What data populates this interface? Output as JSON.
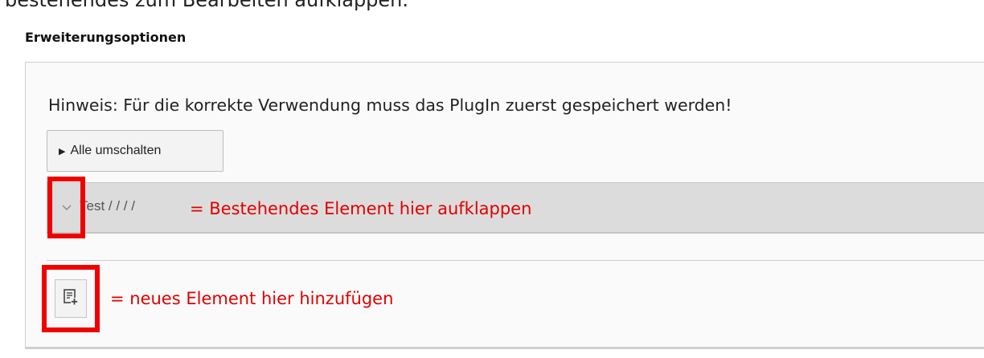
{
  "top_caption": "bestehendes zum Bearbeiten aufklappen.",
  "section_title": "Erweiterungsoptionen",
  "hint": "Hinweis: Für die korrekte Verwendung muss das PlugIn zuerst gespeichert werden!",
  "toggle_all": {
    "icon": "triangle-right-icon",
    "label": "Alle umschalten"
  },
  "element": {
    "title": "Test / / / /",
    "expand_icon": "chevron-down-icon"
  },
  "annotations": {
    "expand": "= Bestehendes Element hier aufklappen",
    "add": "= neues Element hier hinzufügen"
  },
  "add_button": {
    "icon": "document-add-icon"
  },
  "colors": {
    "annotation": "#e00000",
    "highlight_border": "#f00000",
    "row_background": "#dcdcdc"
  }
}
